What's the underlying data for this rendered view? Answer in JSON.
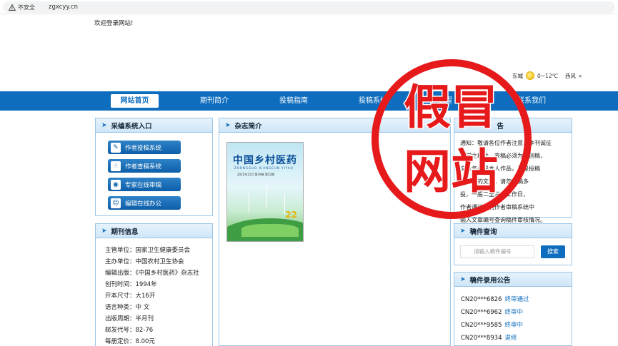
{
  "browser": {
    "security_label": "不安全",
    "url": "zgxcyy.cn"
  },
  "header": {
    "welcome": "欢迎登录网站!"
  },
  "weather": {
    "city": "东城",
    "temp": "0~12℃",
    "wind": "西风",
    "more": "»"
  },
  "nav": {
    "items": [
      "网站首页",
      "期刊简介",
      "投稿指南",
      "投稿系统",
      "流程",
      "联系我们"
    ]
  },
  "left": {
    "system_title": "采编系统入口",
    "system_buttons": [
      "作者投稿系统",
      "作者查稿系统",
      "专家在线审稿",
      "编辑在线办公"
    ],
    "info_title": "期刊信息",
    "info": [
      "主管单位：国家卫生健康委员会",
      "主办单位：中国农村卫生协会",
      "编辑出版：《中国乡村医药》杂志社",
      "创刊时间：1994年",
      "开本尺寸：大16开",
      "语言种类：中 文",
      "出版周期：半月刊",
      "邮发代号：82-76",
      "每册定价：8.00元"
    ]
  },
  "center": {
    "title": "杂志简介",
    "cover_title": "中国乡村医药",
    "cover_pinyin": "ZHONGGUO XIANGCUN YIYAO",
    "cover_issue": "2022年11月 第29卷 第22期",
    "cover_number": "22"
  },
  "right": {
    "notice_title": "告",
    "notice_lines": [
      "通知：敬请各位作者注意，本刊诚征",
      "科学之稿件，来稿必须为原创稿，",
      "文章务必是本人作品，凡是投稿",
      "到本刊的文章，请勿一稿多",
      "投，一般二至三个工作日，",
      "作者通过本刊作者审稿系统中",
      "输入文章编号查询稿件审核情况。"
    ],
    "query_title": "稿件查询",
    "query_placeholder": "请输入稿件编号",
    "query_button": "搜索",
    "ann_title": "稿件录用公告",
    "announcements": [
      {
        "id": "CN20***6826",
        "status": "终审通过"
      },
      {
        "id": "CN20***6962",
        "status": "终审中"
      },
      {
        "id": "CN20***9585",
        "status": "终审中"
      },
      {
        "id": "CN20***8934",
        "status": "退修"
      }
    ]
  },
  "stamp": {
    "line1": "假冒",
    "line2": "网站"
  },
  "colors": {
    "nav_blue": "#0e6dbe",
    "stamp_red": "#e6191b"
  }
}
